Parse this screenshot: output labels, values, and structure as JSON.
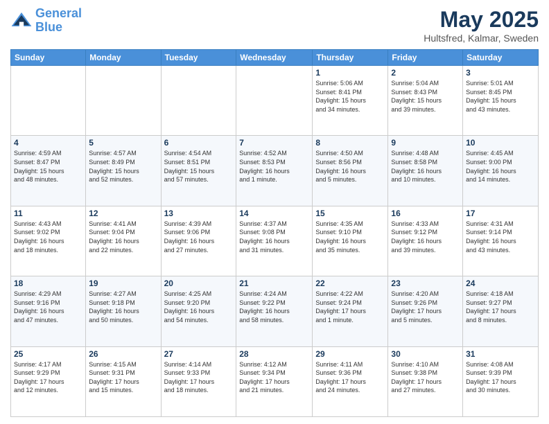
{
  "logo": {
    "line1": "General",
    "line2": "Blue"
  },
  "title": "May 2025",
  "subtitle": "Hultsfred, Kalmar, Sweden",
  "days_of_week": [
    "Sunday",
    "Monday",
    "Tuesday",
    "Wednesday",
    "Thursday",
    "Friday",
    "Saturday"
  ],
  "weeks": [
    [
      {
        "day": "",
        "info": ""
      },
      {
        "day": "",
        "info": ""
      },
      {
        "day": "",
        "info": ""
      },
      {
        "day": "",
        "info": ""
      },
      {
        "day": "1",
        "info": "Sunrise: 5:06 AM\nSunset: 8:41 PM\nDaylight: 15 hours\nand 34 minutes."
      },
      {
        "day": "2",
        "info": "Sunrise: 5:04 AM\nSunset: 8:43 PM\nDaylight: 15 hours\nand 39 minutes."
      },
      {
        "day": "3",
        "info": "Sunrise: 5:01 AM\nSunset: 8:45 PM\nDaylight: 15 hours\nand 43 minutes."
      }
    ],
    [
      {
        "day": "4",
        "info": "Sunrise: 4:59 AM\nSunset: 8:47 PM\nDaylight: 15 hours\nand 48 minutes."
      },
      {
        "day": "5",
        "info": "Sunrise: 4:57 AM\nSunset: 8:49 PM\nDaylight: 15 hours\nand 52 minutes."
      },
      {
        "day": "6",
        "info": "Sunrise: 4:54 AM\nSunset: 8:51 PM\nDaylight: 15 hours\nand 57 minutes."
      },
      {
        "day": "7",
        "info": "Sunrise: 4:52 AM\nSunset: 8:53 PM\nDaylight: 16 hours\nand 1 minute."
      },
      {
        "day": "8",
        "info": "Sunrise: 4:50 AM\nSunset: 8:56 PM\nDaylight: 16 hours\nand 5 minutes."
      },
      {
        "day": "9",
        "info": "Sunrise: 4:48 AM\nSunset: 8:58 PM\nDaylight: 16 hours\nand 10 minutes."
      },
      {
        "day": "10",
        "info": "Sunrise: 4:45 AM\nSunset: 9:00 PM\nDaylight: 16 hours\nand 14 minutes."
      }
    ],
    [
      {
        "day": "11",
        "info": "Sunrise: 4:43 AM\nSunset: 9:02 PM\nDaylight: 16 hours\nand 18 minutes."
      },
      {
        "day": "12",
        "info": "Sunrise: 4:41 AM\nSunset: 9:04 PM\nDaylight: 16 hours\nand 22 minutes."
      },
      {
        "day": "13",
        "info": "Sunrise: 4:39 AM\nSunset: 9:06 PM\nDaylight: 16 hours\nand 27 minutes."
      },
      {
        "day": "14",
        "info": "Sunrise: 4:37 AM\nSunset: 9:08 PM\nDaylight: 16 hours\nand 31 minutes."
      },
      {
        "day": "15",
        "info": "Sunrise: 4:35 AM\nSunset: 9:10 PM\nDaylight: 16 hours\nand 35 minutes."
      },
      {
        "day": "16",
        "info": "Sunrise: 4:33 AM\nSunset: 9:12 PM\nDaylight: 16 hours\nand 39 minutes."
      },
      {
        "day": "17",
        "info": "Sunrise: 4:31 AM\nSunset: 9:14 PM\nDaylight: 16 hours\nand 43 minutes."
      }
    ],
    [
      {
        "day": "18",
        "info": "Sunrise: 4:29 AM\nSunset: 9:16 PM\nDaylight: 16 hours\nand 47 minutes."
      },
      {
        "day": "19",
        "info": "Sunrise: 4:27 AM\nSunset: 9:18 PM\nDaylight: 16 hours\nand 50 minutes."
      },
      {
        "day": "20",
        "info": "Sunrise: 4:25 AM\nSunset: 9:20 PM\nDaylight: 16 hours\nand 54 minutes."
      },
      {
        "day": "21",
        "info": "Sunrise: 4:24 AM\nSunset: 9:22 PM\nDaylight: 16 hours\nand 58 minutes."
      },
      {
        "day": "22",
        "info": "Sunrise: 4:22 AM\nSunset: 9:24 PM\nDaylight: 17 hours\nand 1 minute."
      },
      {
        "day": "23",
        "info": "Sunrise: 4:20 AM\nSunset: 9:26 PM\nDaylight: 17 hours\nand 5 minutes."
      },
      {
        "day": "24",
        "info": "Sunrise: 4:18 AM\nSunset: 9:27 PM\nDaylight: 17 hours\nand 8 minutes."
      }
    ],
    [
      {
        "day": "25",
        "info": "Sunrise: 4:17 AM\nSunset: 9:29 PM\nDaylight: 17 hours\nand 12 minutes."
      },
      {
        "day": "26",
        "info": "Sunrise: 4:15 AM\nSunset: 9:31 PM\nDaylight: 17 hours\nand 15 minutes."
      },
      {
        "day": "27",
        "info": "Sunrise: 4:14 AM\nSunset: 9:33 PM\nDaylight: 17 hours\nand 18 minutes."
      },
      {
        "day": "28",
        "info": "Sunrise: 4:12 AM\nSunset: 9:34 PM\nDaylight: 17 hours\nand 21 minutes."
      },
      {
        "day": "29",
        "info": "Sunrise: 4:11 AM\nSunset: 9:36 PM\nDaylight: 17 hours\nand 24 minutes."
      },
      {
        "day": "30",
        "info": "Sunrise: 4:10 AM\nSunset: 9:38 PM\nDaylight: 17 hours\nand 27 minutes."
      },
      {
        "day": "31",
        "info": "Sunrise: 4:08 AM\nSunset: 9:39 PM\nDaylight: 17 hours\nand 30 minutes."
      }
    ]
  ]
}
